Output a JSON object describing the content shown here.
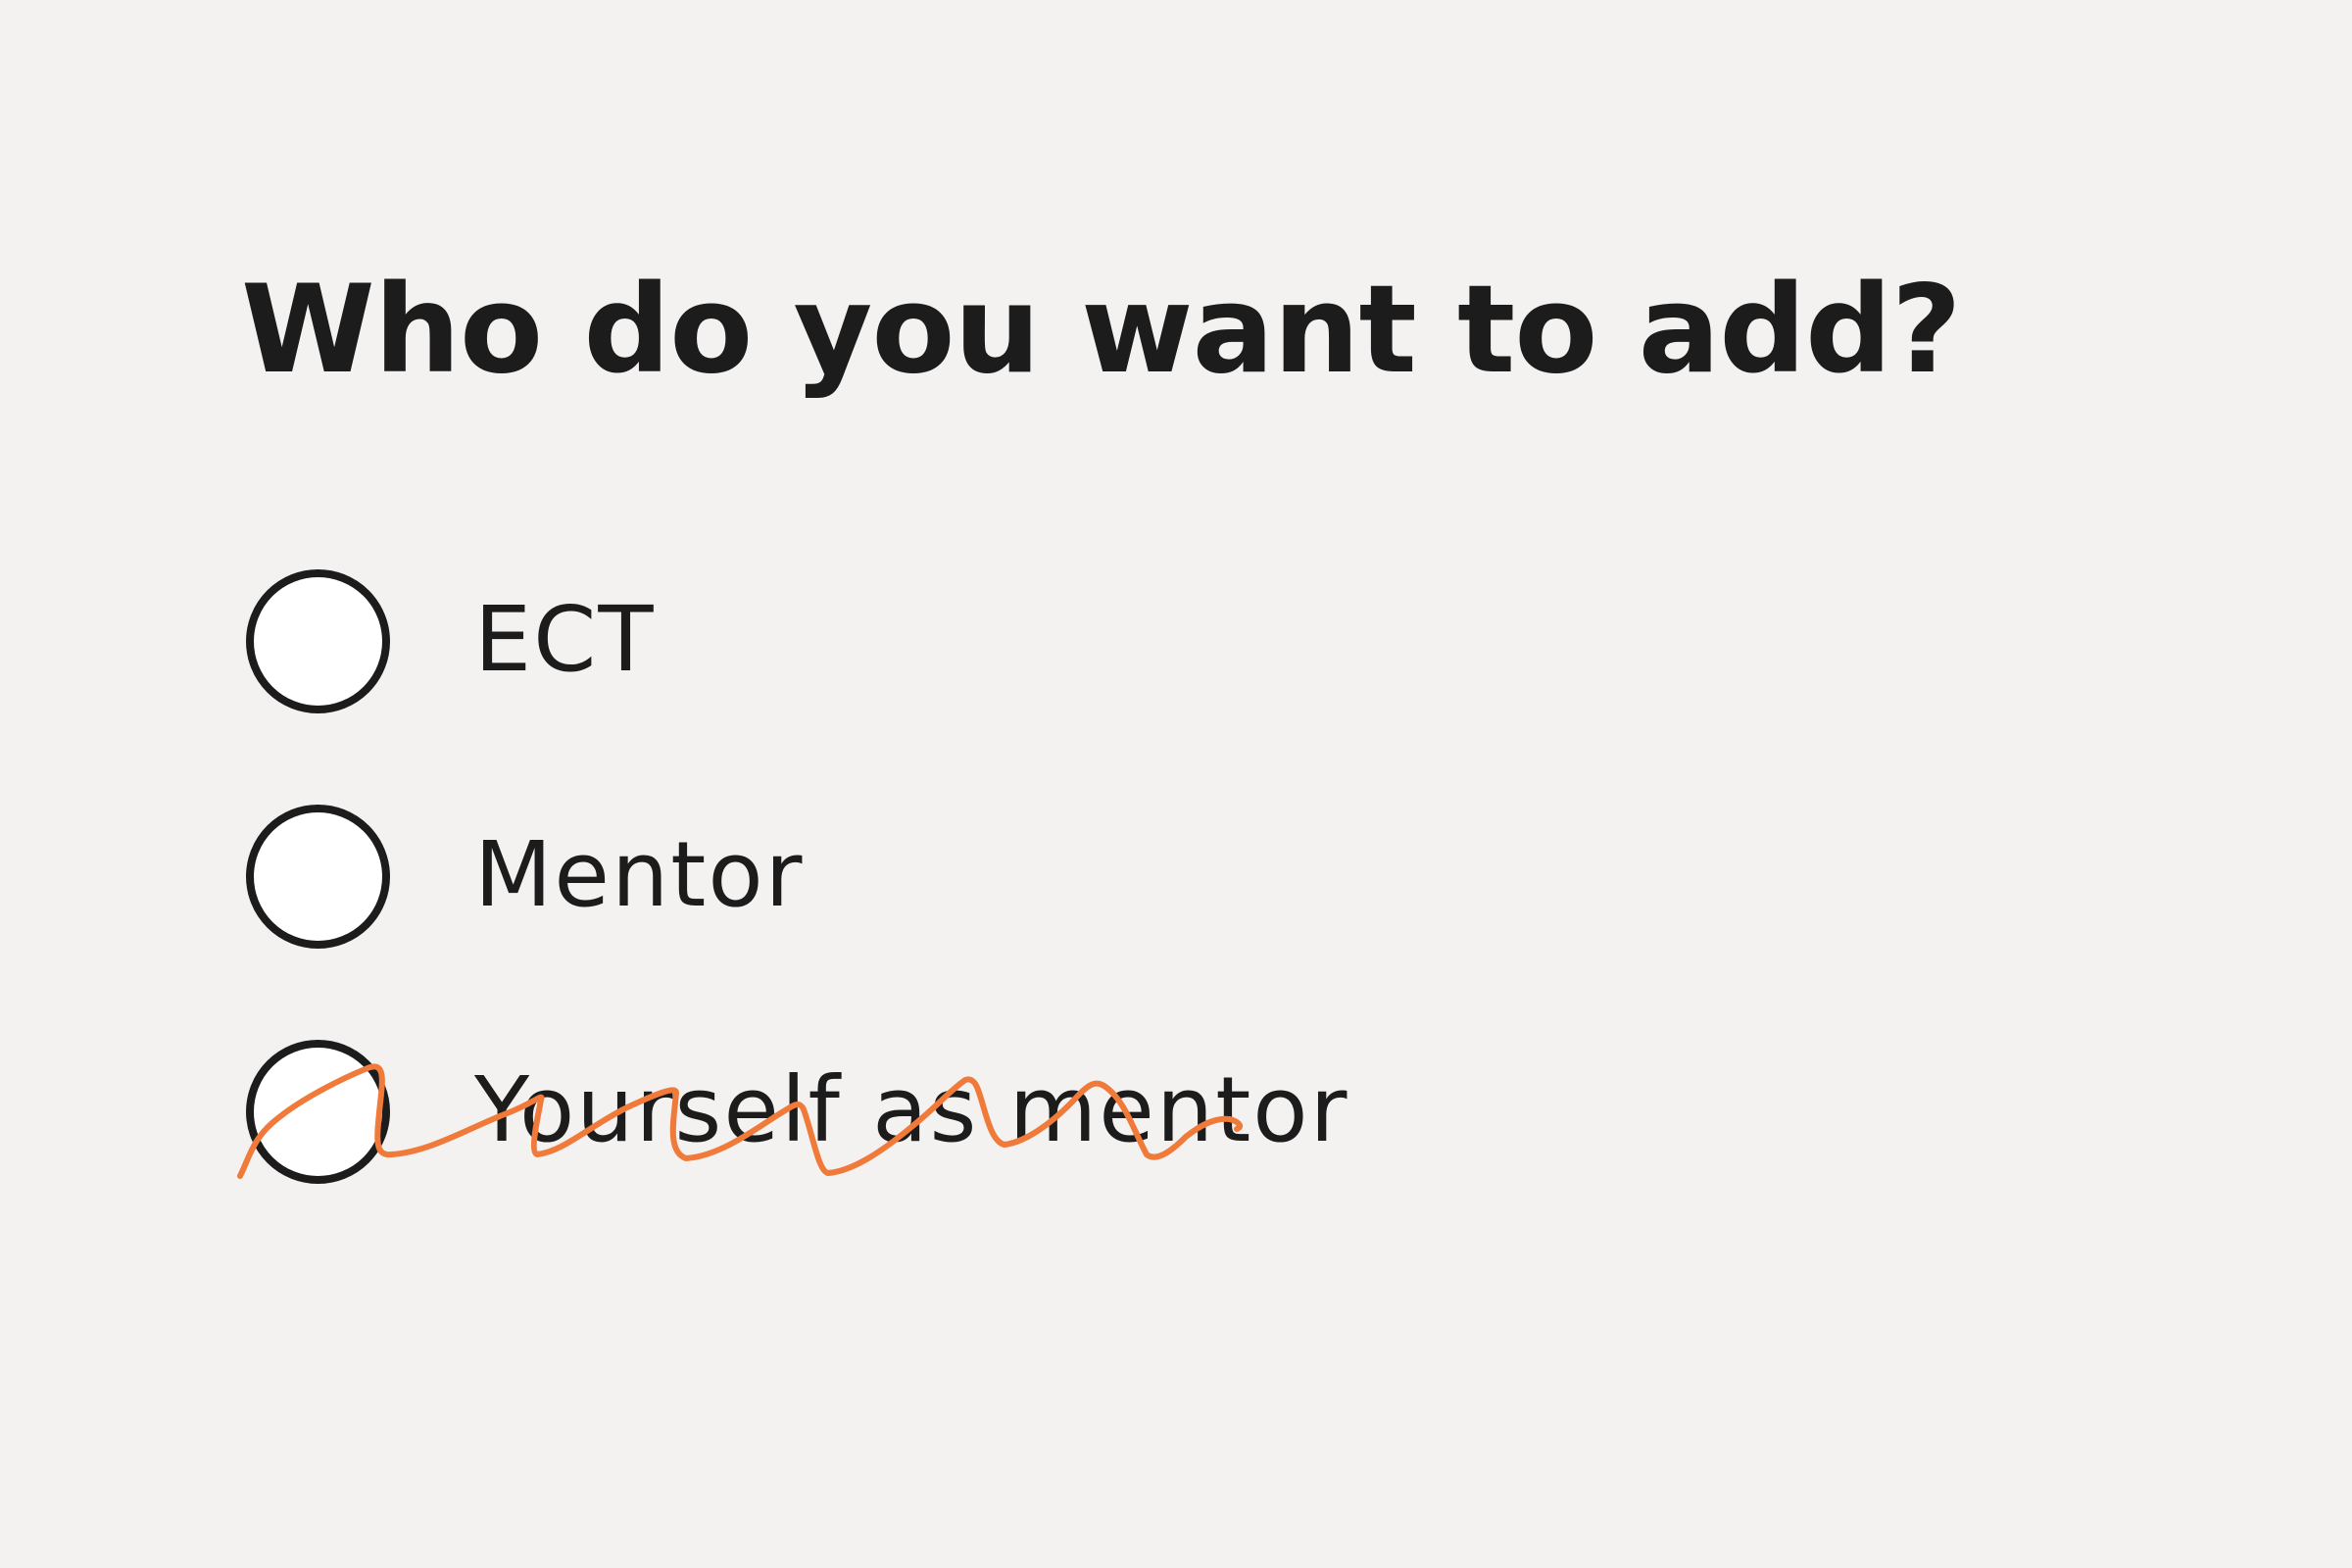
{
  "question": {
    "title": "Who do you want to add?"
  },
  "options": [
    {
      "label": "ECT"
    },
    {
      "label": "Mentor"
    },
    {
      "label": "Yourself as mentor"
    }
  ],
  "annotation": {
    "color": "#f07a3a"
  }
}
